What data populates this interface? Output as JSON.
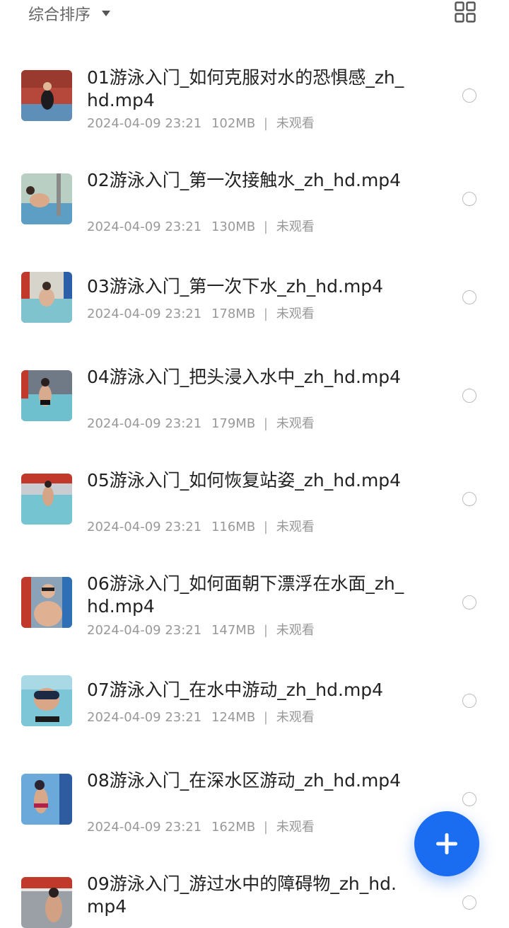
{
  "toolbar": {
    "sort_label": "综合排序",
    "sort_icon": "caret-down-icon",
    "view_icon": "grid-view-icon"
  },
  "files": [
    {
      "title": "01游泳入门_如何克服对水的恐惧感_zh_hd.mp4",
      "date": "2024-04-09 23:21",
      "size": "102MB",
      "status": "未观看"
    },
    {
      "title": "02游泳入门_第一次接触水_zh_hd.mp4",
      "date": "2024-04-09 23:21",
      "size": "130MB",
      "status": "未观看"
    },
    {
      "title": "03游泳入门_第一次下水_zh_hd.mp4",
      "date": "2024-04-09 23:21",
      "size": "178MB",
      "status": "未观看"
    },
    {
      "title": "04游泳入门_把头浸入水中_zh_hd.mp4",
      "date": "2024-04-09 23:21",
      "size": "179MB",
      "status": "未观看"
    },
    {
      "title": "05游泳入门_如何恢复站姿_zh_hd.mp4",
      "date": "2024-04-09 23:21",
      "size": "116MB",
      "status": "未观看"
    },
    {
      "title": "06游泳入门_如何面朝下漂浮在水面_zh_hd.mp4",
      "date": "2024-04-09 23:21",
      "size": "147MB",
      "status": "未观看"
    },
    {
      "title": "07游泳入门_在水中游动_zh_hd.mp4",
      "date": "2024-04-09 23:21",
      "size": "124MB",
      "status": "未观看"
    },
    {
      "title": "08游泳入门_在深水区游动_zh_hd.mp4",
      "date": "2024-04-09 23:21",
      "size": "162MB",
      "status": "未观看"
    },
    {
      "title": "09游泳入门_游过水中的障碍物_zh_hd.mp4",
      "date": "",
      "size": "",
      "status": ""
    }
  ],
  "fab": {
    "icon": "plus-icon"
  },
  "colors": {
    "accent": "#1a6cf0",
    "meta_text": "#999999",
    "title_text": "#222222"
  }
}
